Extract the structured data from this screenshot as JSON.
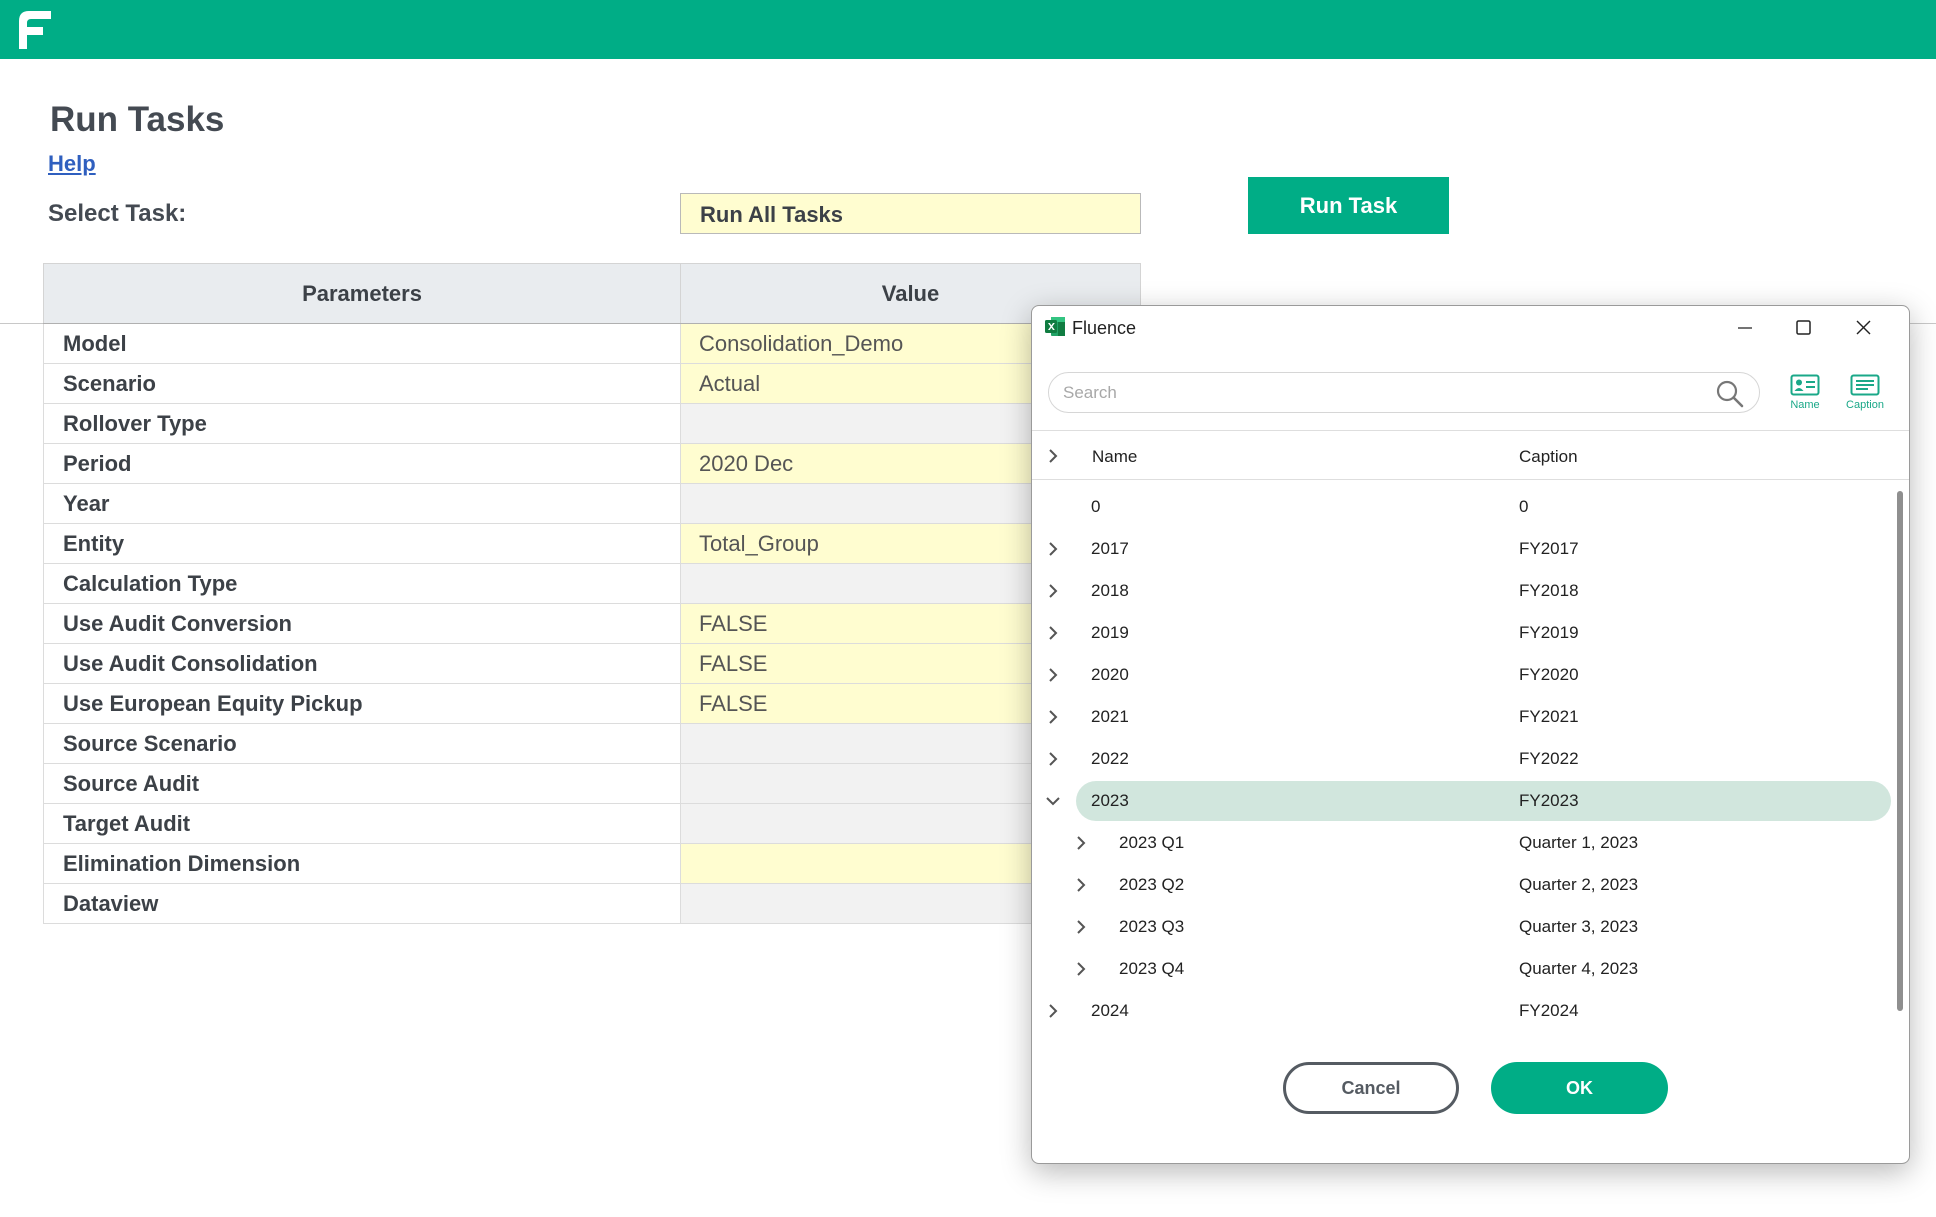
{
  "header": {
    "brand_color": "#00ad86",
    "logo_icon": "fluence-logo-icon"
  },
  "page": {
    "title": "Run Tasks",
    "help_link": "Help",
    "select_label": "Select Task:",
    "selected_task": "Run All Tasks",
    "run_button": "Run Task"
  },
  "params_table": {
    "headers": {
      "parameters": "Parameters",
      "value": "Value"
    },
    "rows": [
      {
        "name": "Model",
        "value": "Consolidation_Demo"
      },
      {
        "name": "Scenario",
        "value": "Actual"
      },
      {
        "name": "Rollover Type",
        "value": ""
      },
      {
        "name": "Period",
        "value": "2020 Dec"
      },
      {
        "name": "Year",
        "value": ""
      },
      {
        "name": "Entity",
        "value": "Total_Group"
      },
      {
        "name": "Calculation Type",
        "value": ""
      },
      {
        "name": "Use Audit Conversion",
        "value": "FALSE"
      },
      {
        "name": "Use Audit Consolidation",
        "value": "FALSE"
      },
      {
        "name": "Use European Equity Pickup",
        "value": "FALSE"
      },
      {
        "name": "Source Scenario",
        "value": ""
      },
      {
        "name": "Source Audit",
        "value": ""
      },
      {
        "name": "Target Audit",
        "value": ""
      },
      {
        "name": "Elimination Dimension",
        "value": ""
      },
      {
        "name": "Dataview",
        "value": ""
      }
    ]
  },
  "dialog": {
    "title": "Fluence",
    "app_icon": "excel-icon",
    "search_placeholder": "Search",
    "tools": {
      "name_label": "Name",
      "caption_label": "Caption"
    },
    "columns": {
      "name": "Name",
      "caption": "Caption"
    },
    "items": [
      {
        "name": "0",
        "caption": "0",
        "level": 0,
        "expand": "none"
      },
      {
        "name": "2017",
        "caption": "FY2017",
        "level": 0,
        "expand": "collapsed"
      },
      {
        "name": "2018",
        "caption": "FY2018",
        "level": 0,
        "expand": "collapsed"
      },
      {
        "name": "2019",
        "caption": "FY2019",
        "level": 0,
        "expand": "collapsed"
      },
      {
        "name": "2020",
        "caption": "FY2020",
        "level": 0,
        "expand": "collapsed"
      },
      {
        "name": "2021",
        "caption": "FY2021",
        "level": 0,
        "expand": "collapsed"
      },
      {
        "name": "2022",
        "caption": "FY2022",
        "level": 0,
        "expand": "collapsed"
      },
      {
        "name": "2023",
        "caption": "FY2023",
        "level": 0,
        "expand": "expanded",
        "selected": true
      },
      {
        "name": "2023 Q1",
        "caption": "Quarter 1, 2023",
        "level": 1,
        "expand": "collapsed"
      },
      {
        "name": "2023 Q2",
        "caption": "Quarter 2, 2023",
        "level": 1,
        "expand": "collapsed"
      },
      {
        "name": "2023 Q3",
        "caption": "Quarter 3, 2023",
        "level": 1,
        "expand": "collapsed"
      },
      {
        "name": "2023 Q4",
        "caption": "Quarter 4, 2023",
        "level": 1,
        "expand": "collapsed"
      },
      {
        "name": "2024",
        "caption": "FY2024",
        "level": 0,
        "expand": "collapsed"
      }
    ],
    "cancel_button": "Cancel",
    "ok_button": "OK"
  }
}
